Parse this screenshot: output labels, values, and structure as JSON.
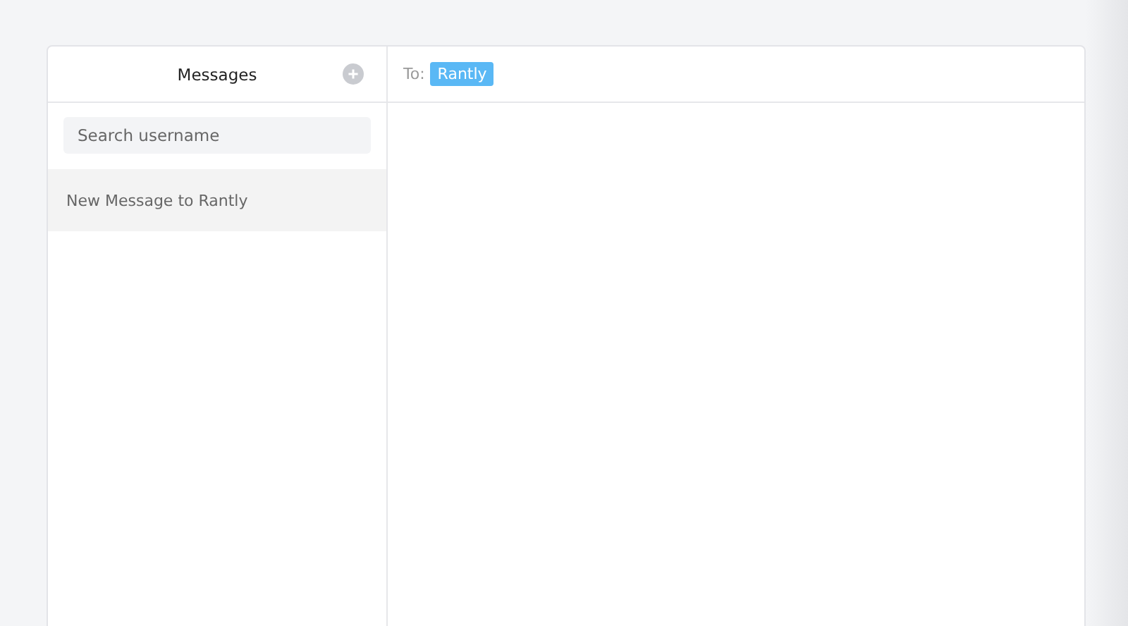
{
  "sidebar": {
    "title": "Messages",
    "search": {
      "placeholder": "Search username"
    },
    "conversations": [
      {
        "label": "New Message to Rantly",
        "selected": true
      }
    ]
  },
  "compose": {
    "to_label": "To:",
    "recipients": [
      "Rantly"
    ]
  }
}
